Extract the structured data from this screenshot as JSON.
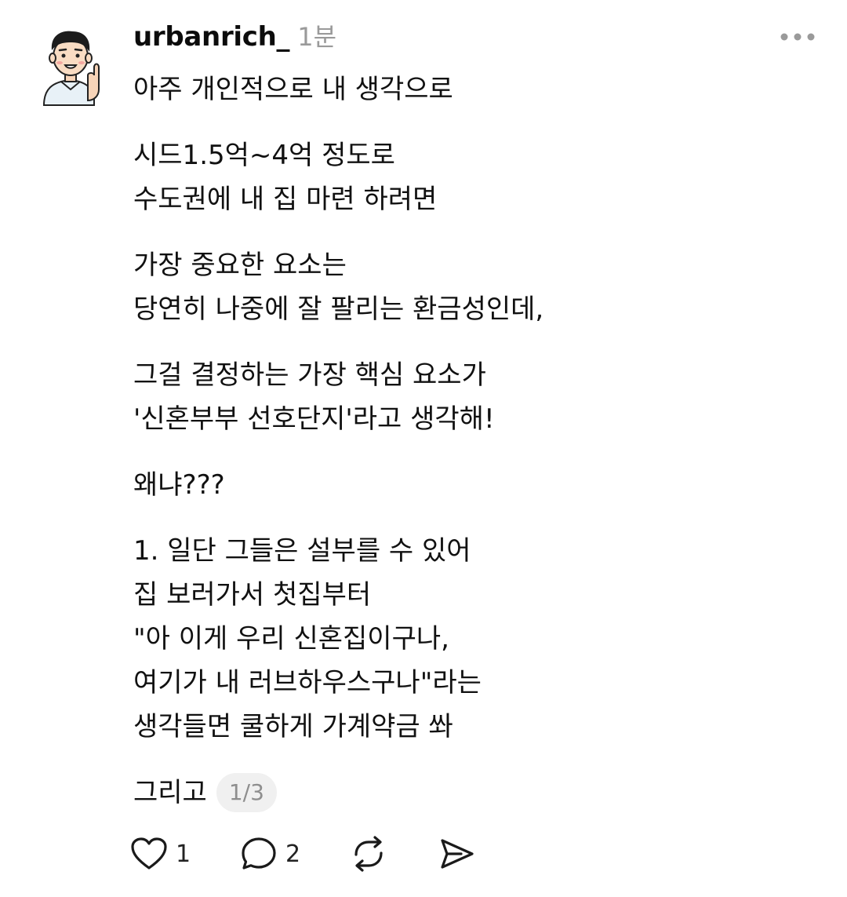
{
  "post": {
    "author": {
      "username": "urbanrich_",
      "timestamp": "1분"
    },
    "paragraphs": [
      [
        "아주 개인적으로 내 생각으로"
      ],
      [
        "시드1.5억~4억 정도로",
        "수도권에 내 집 마련 하려면"
      ],
      [
        "가장 중요한 요소는",
        "당연히 나중에 잘 팔리는 환금성인데,"
      ],
      [
        "그걸 결정하는 가장 핵심 요소가",
        "'신혼부부 선호단지'라고 생각해!"
      ],
      [
        "왜냐???"
      ],
      [
        "1. 일단 그들은 설부를 수 있어",
        "집 보러가서 첫집부터",
        "\"아 이게 우리 신혼집이구나,",
        "여기가 내 러브하우스구나\"라는",
        "생각들면 쿨하게 가계약금 쏴"
      ]
    ],
    "last_line": "그리고",
    "page_indicator": "1/3",
    "actions": {
      "likes": "1",
      "replies": "2"
    },
    "icons": {
      "avatar": "avatar-cartoon-man-pointing",
      "more": "more-horizontal-icon",
      "like": "heart-icon",
      "reply": "comment-bubble-icon",
      "repost": "repost-icon",
      "share": "send-icon"
    },
    "colors": {
      "text": "#111111",
      "muted": "#9a9a9a",
      "badge_bg": "#f0f0f0"
    }
  }
}
